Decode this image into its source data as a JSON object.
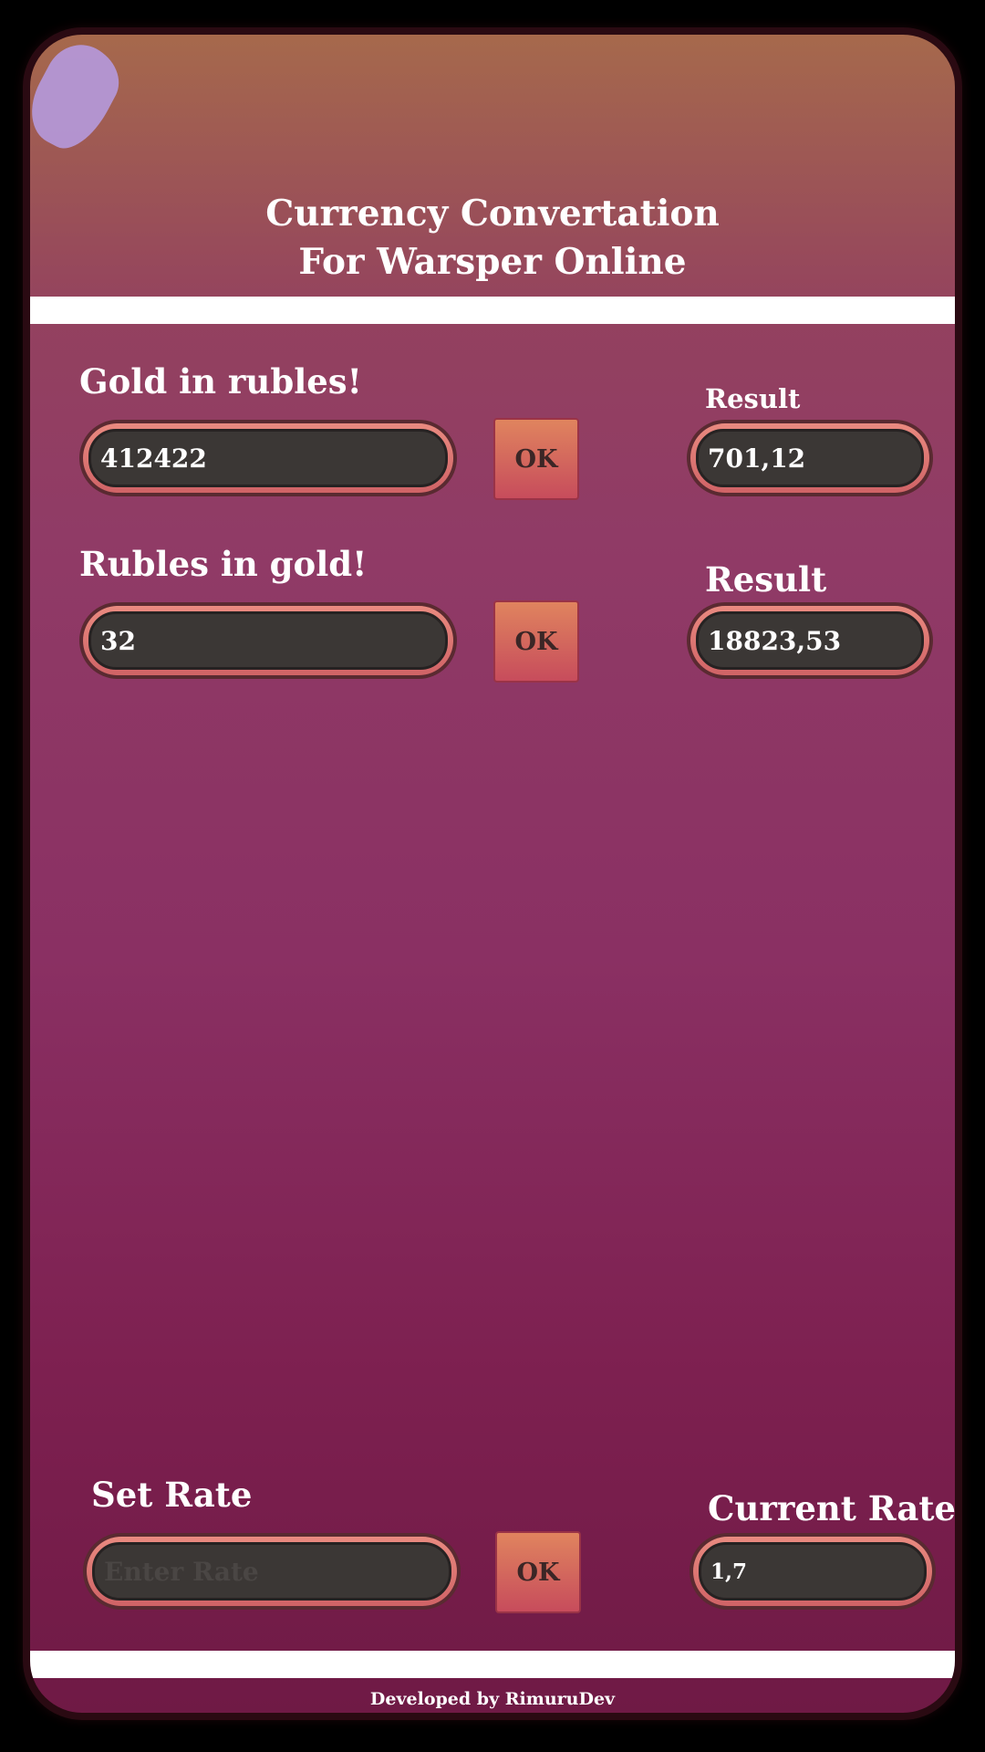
{
  "header": {
    "title_line1": "Currency Convertation",
    "title_line2": "For Warsper Online"
  },
  "gold_to_rubles": {
    "label": "Gold in rubles!",
    "input_value": "412422",
    "button_label": "OK",
    "result_label": "Result",
    "result_value": "701,12"
  },
  "rubles_to_gold": {
    "label": "Rubles in gold!",
    "input_value": "32",
    "button_label": "OK",
    "result_label": "Result",
    "result_value": "18823,53"
  },
  "rate": {
    "label": "Set Rate",
    "input_placeholder": "Enter Rate",
    "button_label": "OK",
    "current_label": "Current Rate",
    "current_value": "1,7"
  },
  "footer": {
    "text": "Developed by RimuruDev"
  },
  "colors": {
    "background_top": "#a6694c",
    "background_main": "#8a3063",
    "field_ring": "#e98a80",
    "field_fill": "#3b3735",
    "button": "#d06366",
    "blob": "#b497d6"
  }
}
